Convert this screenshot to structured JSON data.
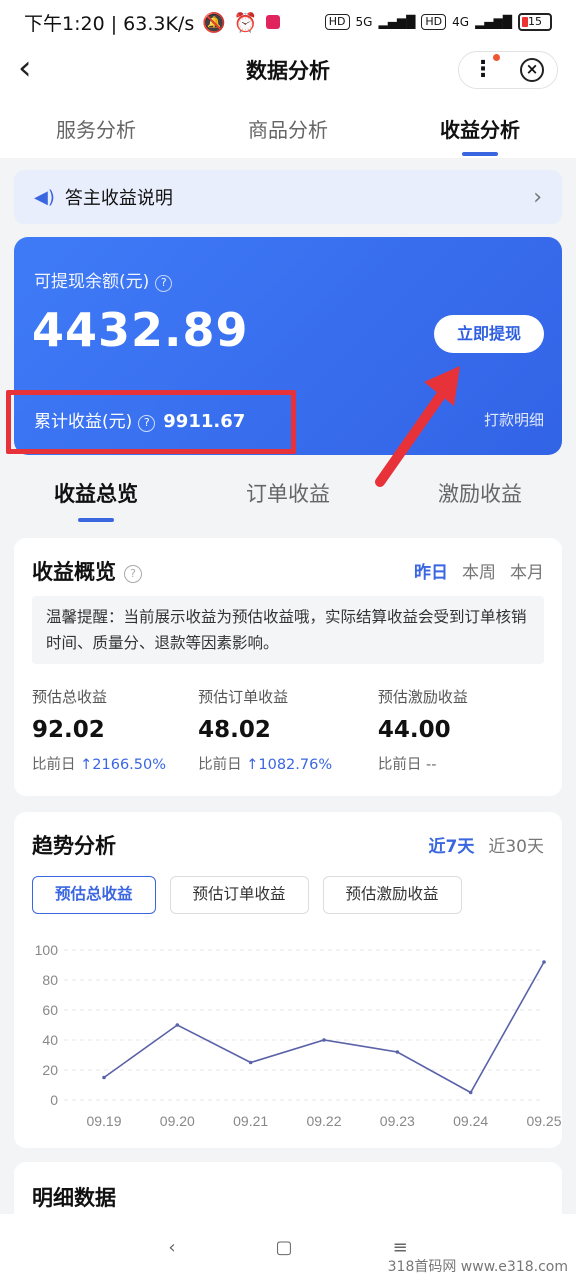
{
  "status_bar": {
    "time_speed": "下午1:20 | 63.3K/s",
    "icons": [
      "mute-bell-icon",
      "alarm-icon",
      "app-badge-icon"
    ],
    "hd1": "HD",
    "net1": "5G",
    "hd2": "HD",
    "net2": "4G",
    "battery": "15"
  },
  "navbar": {
    "back": "‹",
    "title": "数据分析",
    "menu": "⋮",
    "close": "×"
  },
  "top_tabs": [
    {
      "label": "服务分析",
      "active": false
    },
    {
      "label": "商品分析",
      "active": false
    },
    {
      "label": "收益分析",
      "active": true
    }
  ],
  "notice": {
    "text": "答主收益说明",
    "arrow": "›"
  },
  "balance": {
    "label": "可提现余额(元)",
    "amount": "4432.89",
    "withdraw_button": "立即提现",
    "cumulative_label": "累计收益(元)",
    "cumulative_value": "9911.67",
    "payment_detail": "打款明细"
  },
  "sub_tabs": [
    {
      "label": "收益总览",
      "active": true
    },
    {
      "label": "订单收益",
      "active": false
    },
    {
      "label": "激励收益",
      "active": false
    }
  ],
  "overview": {
    "title": "收益概览",
    "periods": [
      {
        "label": "昨日",
        "active": true
      },
      {
        "label": "本周",
        "active": false
      },
      {
        "label": "本月",
        "active": false
      }
    ],
    "tip": "温馨提醒：当前展示收益为预估收益哦，实际结算收益会受到订单核销时间、质量分、退款等因素影响。",
    "metrics": [
      {
        "label": "预估总收益",
        "value": "92.02",
        "compare_label": "比前日",
        "arrow": "↑",
        "compare": "2166.50%"
      },
      {
        "label": "预估订单收益",
        "value": "48.02",
        "compare_label": "比前日",
        "arrow": "↑",
        "compare": "1082.76%"
      },
      {
        "label": "预估激励收益",
        "value": "44.00",
        "compare_label": "比前日",
        "arrow": "",
        "compare": "--"
      }
    ]
  },
  "trend": {
    "title": "趋势分析",
    "ranges": [
      {
        "label": "近7天",
        "active": true
      },
      {
        "label": "近30天",
        "active": false
      }
    ],
    "chips": [
      {
        "label": "预估总收益",
        "active": true
      },
      {
        "label": "预估订单收益",
        "active": false
      },
      {
        "label": "预估激励收益",
        "active": false
      }
    ]
  },
  "chart_data": {
    "type": "line",
    "categories": [
      "09.19",
      "09.20",
      "09.21",
      "09.22",
      "09.23",
      "09.24",
      "09.25"
    ],
    "values": [
      15,
      50,
      25,
      40,
      32,
      5,
      92
    ],
    "yticks": [
      0,
      20,
      40,
      60,
      80,
      100
    ],
    "ylim": [
      0,
      100
    ],
    "grid": true,
    "line_color": "#5a62a8"
  },
  "detail": {
    "title": "明细数据"
  },
  "bottom_nav": {
    "back": "‹",
    "home": "▢",
    "menu": "≡"
  },
  "watermark": "318首码网 www.e318.com"
}
